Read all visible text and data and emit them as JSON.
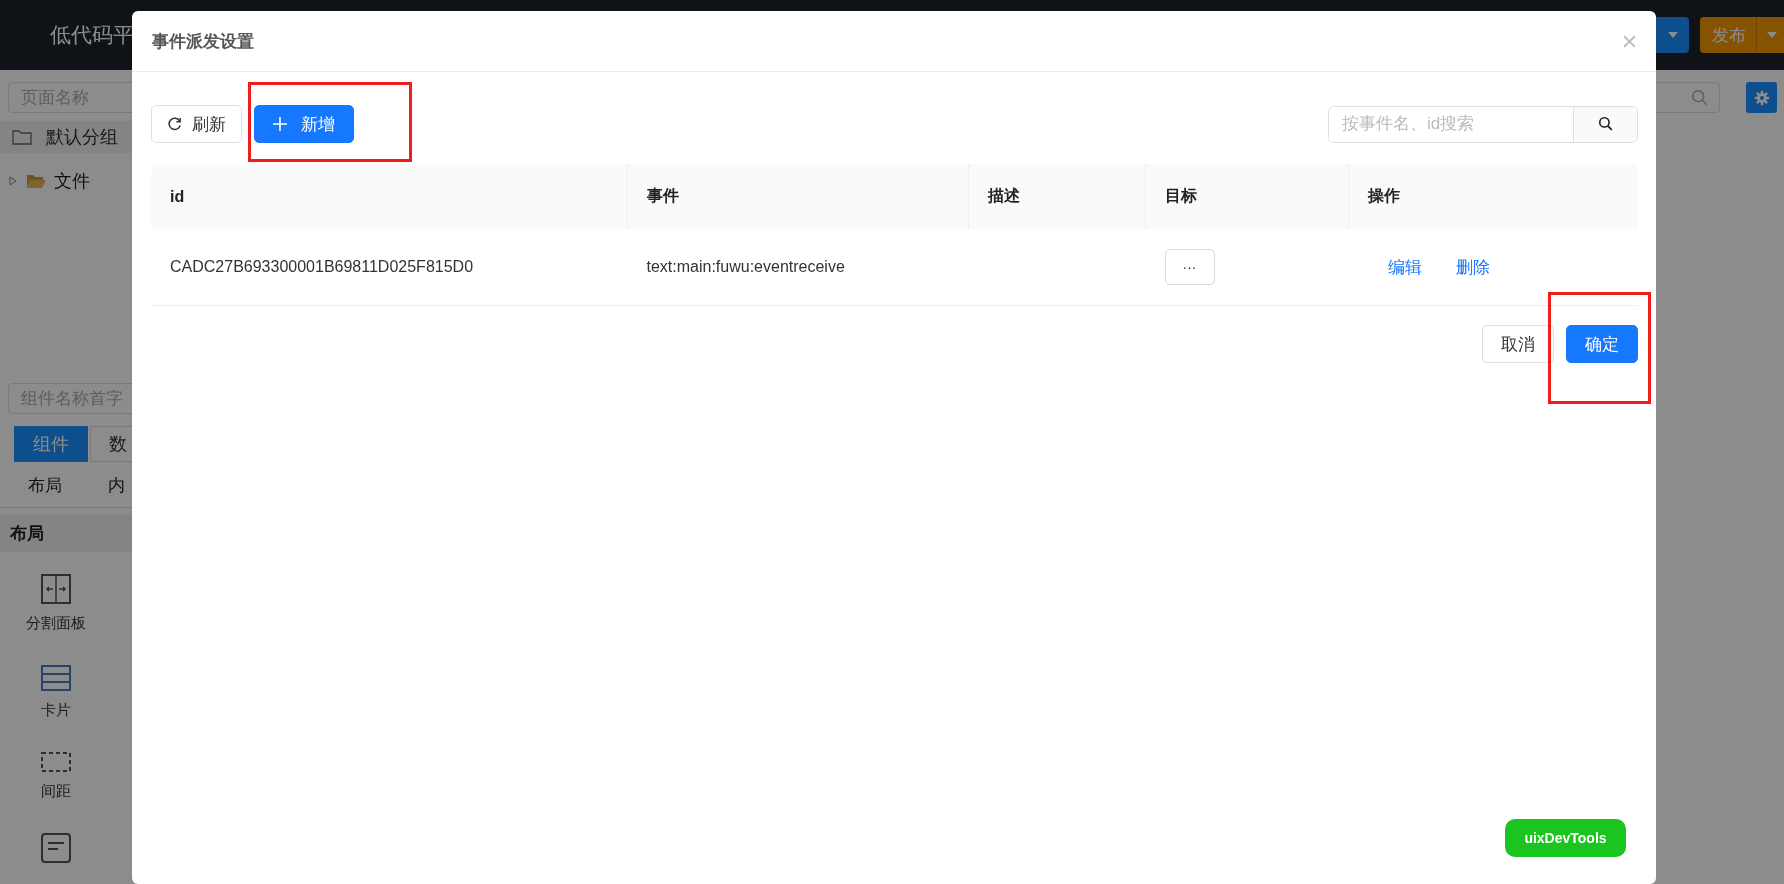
{
  "app": {
    "title": "低代码平",
    "publish_button": "发布",
    "page_search": {
      "placeholder": "页面名称"
    },
    "group": "默认分组",
    "tree": [
      {
        "label": "文件",
        "expanded": false
      }
    ],
    "component_search": {
      "placeholder": "组件名称首字"
    },
    "tabs": [
      {
        "label": "组件",
        "selected": true
      },
      {
        "label": "数",
        "selected": false
      }
    ],
    "categories": [
      "布局",
      "内"
    ],
    "section": "布局",
    "components": [
      {
        "label": "分割面板",
        "kind": "split"
      },
      {
        "label": "卡片",
        "kind": "card"
      },
      {
        "label": "间距",
        "kind": "spacer"
      },
      {
        "kind": "form"
      }
    ]
  },
  "dialog": {
    "title": "事件派发设置",
    "toolbar": [
      {
        "label": "刷新",
        "kind": "refresh",
        "highlighted": false
      },
      {
        "label": "新增",
        "kind": "add",
        "highlighted": true
      }
    ],
    "search": {
      "placeholder": "按事件名、id搜索"
    },
    "table": {
      "columns": [
        "id",
        "事件",
        "描述",
        "目标",
        "操作"
      ],
      "rows": [
        {
          "id": "CADC27B693300001B69811D025F815D0",
          "event": "text:main:fuwu:eventreceive",
          "target": "···",
          "actions": [
            "编辑",
            "删除"
          ]
        }
      ]
    },
    "footer": [
      {
        "label": "取消",
        "primary": false,
        "highlighted": false
      },
      {
        "label": "确定",
        "primary": true,
        "highlighted": true
      }
    ]
  },
  "devtools_button": "uixDevTools"
}
